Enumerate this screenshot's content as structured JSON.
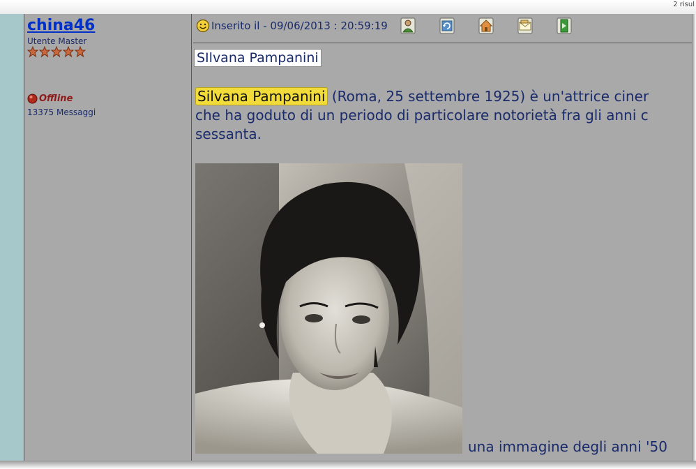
{
  "topbar": {
    "results": "2 risul"
  },
  "author": {
    "name": "china46",
    "rank": "Utente Master",
    "stars": 5,
    "status": "Offline",
    "messages": "13375 Messaggi"
  },
  "post": {
    "date": "Inserito il - 09/06/2013 : 20:59:19",
    "title": "SIlvana Pampanini",
    "highlight": "Silvana Pampanini",
    "line1_rest": " (Roma, 25 settembre 1925) è un'attrice ciner",
    "line2": "che ha goduto di un periodo di particolare notorietà fra gli anni c",
    "line3": "sessanta.",
    "caption": "una immagine degli anni '50"
  },
  "icons": {
    "smiley": "smiley-icon",
    "toolbar": [
      "profile-icon",
      "refresh-icon",
      "home-icon",
      "email-icon",
      "bookmark-icon"
    ]
  },
  "colors": {
    "teal_strip": "#a6c8ca",
    "panel_gray": "#a9a9a9",
    "author_link": "#0030c8",
    "body_text": "#1a2b6b",
    "highlight": "#f2dc3a",
    "offline": "#8e1a1a"
  }
}
